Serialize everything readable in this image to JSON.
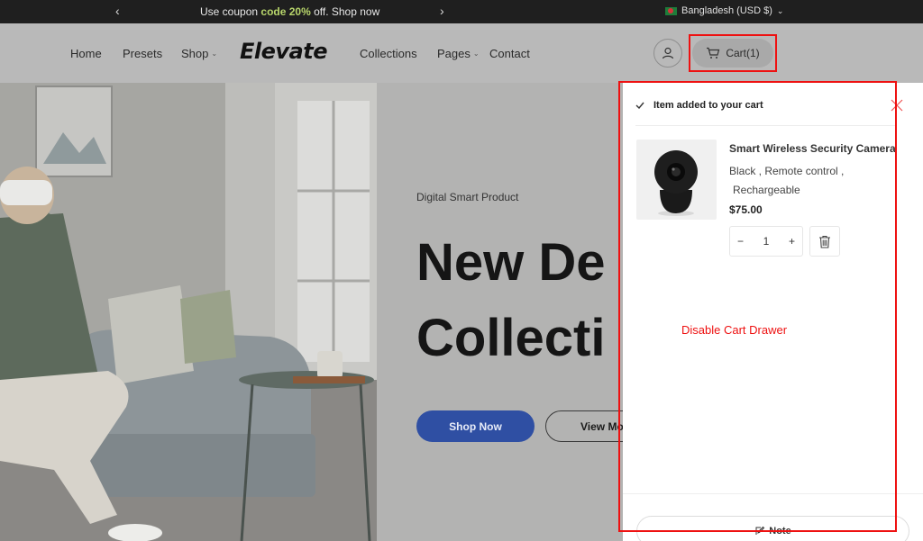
{
  "announcement": {
    "prefix": "Use coupon ",
    "code": "code 20%",
    "suffix": " off. Shop now",
    "prev_icon": "chevron-left-icon",
    "next_icon": "chevron-right-icon"
  },
  "region": {
    "label": "Bangladesh (USD $)",
    "flag": "bangladesh-flag-icon"
  },
  "nav": {
    "home": "Home",
    "presets": "Presets",
    "shop": "Shop",
    "collections": "Collections",
    "pages": "Pages",
    "contact": "Contact"
  },
  "logo": "Elevate",
  "cart": {
    "label": "Cart(1)",
    "icon": "cart-icon"
  },
  "hero": {
    "subtitle": "Digital Smart Product",
    "title_line1": "New De",
    "title_line2": "Collecti",
    "primary_button": "Shop Now",
    "secondary_button": "View Mo"
  },
  "drawer": {
    "added_message": "Item added to your cart",
    "product": {
      "name": "Smart Wireless Security Camera",
      "options_line1": "Black ,  Remote control ,",
      "options_line2": "Rechargeable",
      "price": "$75.00",
      "quantity": "1",
      "minus": "−",
      "plus": "+"
    },
    "annotation": "Disable Cart Drawer",
    "note_label": "Note"
  },
  "colors": {
    "accent_button": "#2f4fa3",
    "coupon_highlight": "#b8d66b",
    "annotation_red": "#e11111"
  }
}
